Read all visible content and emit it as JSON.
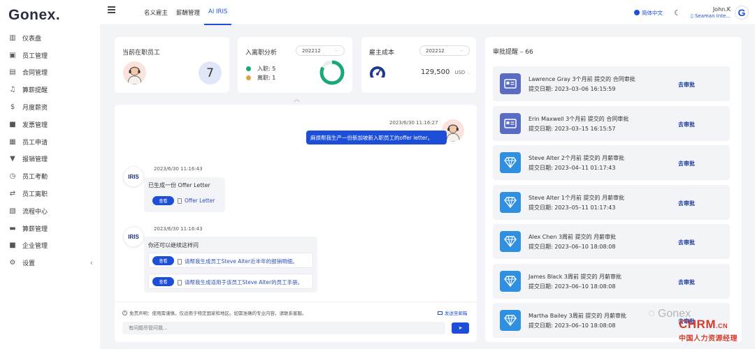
{
  "brand": {
    "logo_text": "Gonex",
    "logo_dot": "."
  },
  "sidebar": {
    "items": [
      {
        "label": "仪表盘",
        "icon": "bar-chart-icon"
      },
      {
        "label": "员工管理",
        "icon": "id-card-icon"
      },
      {
        "label": "合同管理",
        "icon": "document-icon"
      },
      {
        "label": "算薪提醒",
        "icon": "bell-icon"
      },
      {
        "label": "月度薪资",
        "icon": "dollar-icon"
      },
      {
        "label": "发票管理",
        "icon": "briefcase-icon"
      },
      {
        "label": "员工申请",
        "icon": "contact-card-icon"
      },
      {
        "label": "报销管理",
        "icon": "pin-icon"
      },
      {
        "label": "员工考勤",
        "icon": "clock-icon"
      },
      {
        "label": "员工离职",
        "icon": "swap-icon"
      },
      {
        "label": "流程中心",
        "icon": "calendar-icon"
      },
      {
        "label": "算薪管理",
        "icon": "ledger-icon"
      },
      {
        "label": "企业管理",
        "icon": "building-icon"
      },
      {
        "label": "设置",
        "icon": "gear-icon"
      }
    ],
    "collapse_glyph": "‹"
  },
  "topbar": {
    "tabs": [
      {
        "label": "名义雇主",
        "active": false
      },
      {
        "label": "薪酬管理",
        "active": false
      },
      {
        "label": "AI IRIS",
        "active": true
      }
    ],
    "language": "简体中文",
    "user_name": "John.K",
    "user_org": "Seaman Inte...",
    "avatar_letter": "G"
  },
  "stats": {
    "employees": {
      "title": "当前在职员工",
      "count": "7"
    },
    "turnover": {
      "title": "入离职分析",
      "period": "202212",
      "join_label": "入职:",
      "join_value": "5",
      "leave_label": "离职:",
      "leave_value": "1",
      "join_color": "#1aa87a",
      "leave_color": "#d9a441",
      "join_fraction": 0.83
    },
    "cost": {
      "title": "雇主成本",
      "period": "202212",
      "value": "129,500",
      "currency": "USD"
    }
  },
  "chat": {
    "user_msg_time": "2023/6/30 11:16:27",
    "user_msg": "麻烦帮我生产一份新加坡新入职员工的offer letter。",
    "bot_name": "IRIS",
    "bot1": {
      "time": "2023/6/30 11:16:43",
      "text": "已生成一份 Offer Letter",
      "view_label": "查看",
      "link": "Offer Letter"
    },
    "bot2": {
      "time": "2023/6/30 11:16:43",
      "text": "你还可以继续这样问",
      "suggestions": [
        {
          "view_label": "查看",
          "text": "请帮我生成员工Steve Alter近半年的报销明细。"
        },
        {
          "view_label": "查看",
          "text": "请帮我生成适用于该员工Steve Alter的员工手册。"
        }
      ]
    },
    "disclaimer": "免责声明：使用需谨慎，仅适用于特定国家和地区。如需准确的专业内容，请联系客服。",
    "email_label": "发送至邮箱",
    "input_placeholder": "有问题尽管问我..."
  },
  "approvals": {
    "title": "审批提醒 – 66",
    "go_label": "去审批",
    "items": [
      {
        "line1": "Lawrence Gray 3个月前 提交的 合同审批",
        "line2": "提交日期: 2023–03–06 16:15:59",
        "type": "contract",
        "icon": "contract-icon"
      },
      {
        "line1": "Erin Maxwell 3个月前 提交的 合同审批",
        "line2": "提交日期: 2023–03–15 16:15:57",
        "type": "contract",
        "icon": "contract-icon"
      },
      {
        "line1": "Steve Alter 2个月前 提交的 月薪审批",
        "line2": "提交日期: 2023–04–11 01:17:43",
        "type": "payroll",
        "icon": "diamond-icon"
      },
      {
        "line1": "Steve Alter 1个月前 提交的 月薪审批",
        "line2": "提交日期: 2023–05–11 01:17:43",
        "type": "payroll",
        "icon": "diamond-icon"
      },
      {
        "line1": "Alex Chen 3周前 提交的 月薪审批",
        "line2": "提交日期: 2023–06–10 18:08:08",
        "type": "payroll",
        "icon": "diamond-icon"
      },
      {
        "line1": "James Black 3周前 提交的 月薪审批",
        "line2": "提交日期: 2023–06–10 18:08:08",
        "type": "payroll",
        "icon": "diamond-icon"
      },
      {
        "line1": "Martha Bailey 3周前 提交的 月薪审批",
        "line2": "提交日期: 2023–06–10 18:08:08",
        "type": "payroll",
        "icon": "diamond-icon"
      }
    ]
  },
  "watermark": {
    "text": "Gonex",
    "chrm": "CHRM",
    "chrm_cn": ".CN",
    "chrm_sub": "中国人力资源经理"
  }
}
